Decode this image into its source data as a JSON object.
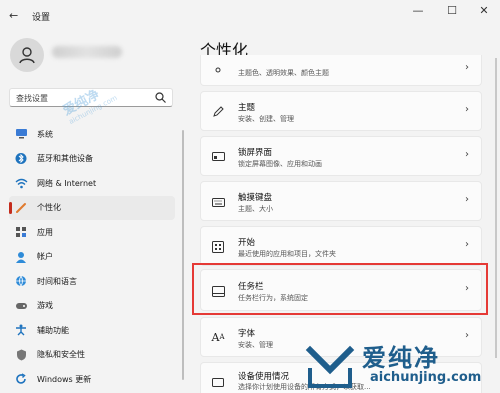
{
  "window": {
    "title": "设置",
    "back_glyph": "←",
    "minimize_glyph": "—",
    "maximize_glyph": "☐",
    "close_glyph": "✕"
  },
  "search": {
    "placeholder": "查找设置"
  },
  "sidebar": {
    "items": [
      {
        "label": "系统",
        "icon": "monitor-icon",
        "active": false
      },
      {
        "label": "蓝牙和其他设备",
        "icon": "bluetooth-icon",
        "active": false
      },
      {
        "label": "网络 & Internet",
        "icon": "wifi-icon",
        "active": false
      },
      {
        "label": "个性化",
        "icon": "brush-icon",
        "active": true
      },
      {
        "label": "应用",
        "icon": "apps-icon",
        "active": false
      },
      {
        "label": "帐户",
        "icon": "person-icon",
        "active": false
      },
      {
        "label": "时间和语言",
        "icon": "globe-icon",
        "active": false
      },
      {
        "label": "游戏",
        "icon": "gamepad-icon",
        "active": false
      },
      {
        "label": "辅助功能",
        "icon": "accessibility-icon",
        "active": false
      },
      {
        "label": "隐私和安全性",
        "icon": "shield-icon",
        "active": false
      },
      {
        "label": "Windows 更新",
        "icon": "update-icon",
        "active": false
      }
    ]
  },
  "main": {
    "title": "个性化",
    "cards": [
      {
        "title": "",
        "subtitle": "主题色、透明效果、颜色主题",
        "icon": "palette-icon"
      },
      {
        "title": "主题",
        "subtitle": "安装、创建、管理",
        "icon": "pen-icon"
      },
      {
        "title": "锁屏界面",
        "subtitle": "锁定屏幕图像、应用和动画",
        "icon": "lockscreen-icon"
      },
      {
        "title": "触摸键盘",
        "subtitle": "主题、大小",
        "icon": "keyboard-icon"
      },
      {
        "title": "开始",
        "subtitle": "最近使用的应用和项目，文件夹",
        "icon": "start-icon"
      },
      {
        "title": "任务栏",
        "subtitle": "任务栏行为，系统固定",
        "icon": "taskbar-icon"
      },
      {
        "title": "字体",
        "subtitle": "安装、管理",
        "icon": "font-icon"
      },
      {
        "title": "设备使用情况",
        "subtitle": "选择你计划使用设备的所有方式，以获取...",
        "icon": "device-icon"
      }
    ]
  },
  "watermark": {
    "center_cn": "爱纯净",
    "center_en": "aichunjing.com",
    "corner_cn": "爱纯净",
    "corner_en": "aichunjing.com"
  },
  "colors": {
    "accent": "#c42b1c",
    "highlight_box": "#e53935",
    "watermark": "#1f5e8c"
  }
}
